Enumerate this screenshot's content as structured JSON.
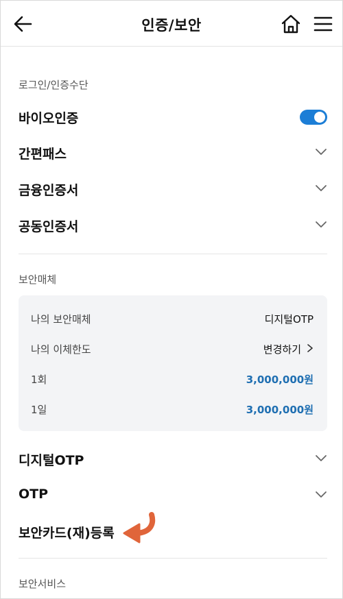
{
  "header": {
    "title": "인증/보안"
  },
  "login_section": {
    "label": "로그인/인증수단",
    "items": [
      {
        "label": "바이오인증"
      },
      {
        "label": "간편패스"
      },
      {
        "label": "금융인증서"
      },
      {
        "label": "공동인증서"
      }
    ],
    "bio_toggle_on": true
  },
  "security_section": {
    "label": "보안매체",
    "card": {
      "my_media_label": "나의 보안매체",
      "my_media_value": "디지털OTP",
      "limit_label": "나의 이체한도",
      "limit_action": "변경하기",
      "per_once_label": "1회",
      "per_once_value": "3,000,000원",
      "per_day_label": "1일",
      "per_day_value": "3,000,000원"
    },
    "items": [
      {
        "label": "디지털OTP"
      },
      {
        "label": "OTP"
      },
      {
        "label": "보안카드(재)등록"
      }
    ]
  },
  "service_section": {
    "label": "보안서비스"
  },
  "colors": {
    "accent": "#1c7ed6",
    "value_blue": "#1f6fb2",
    "annotation_arrow": "#e0653a"
  },
  "icons": [
    "back-arrow-icon",
    "home-icon",
    "hamburger-menu-icon",
    "chevron-down-icon",
    "chevron-right-icon",
    "curved-arrow-icon"
  ]
}
